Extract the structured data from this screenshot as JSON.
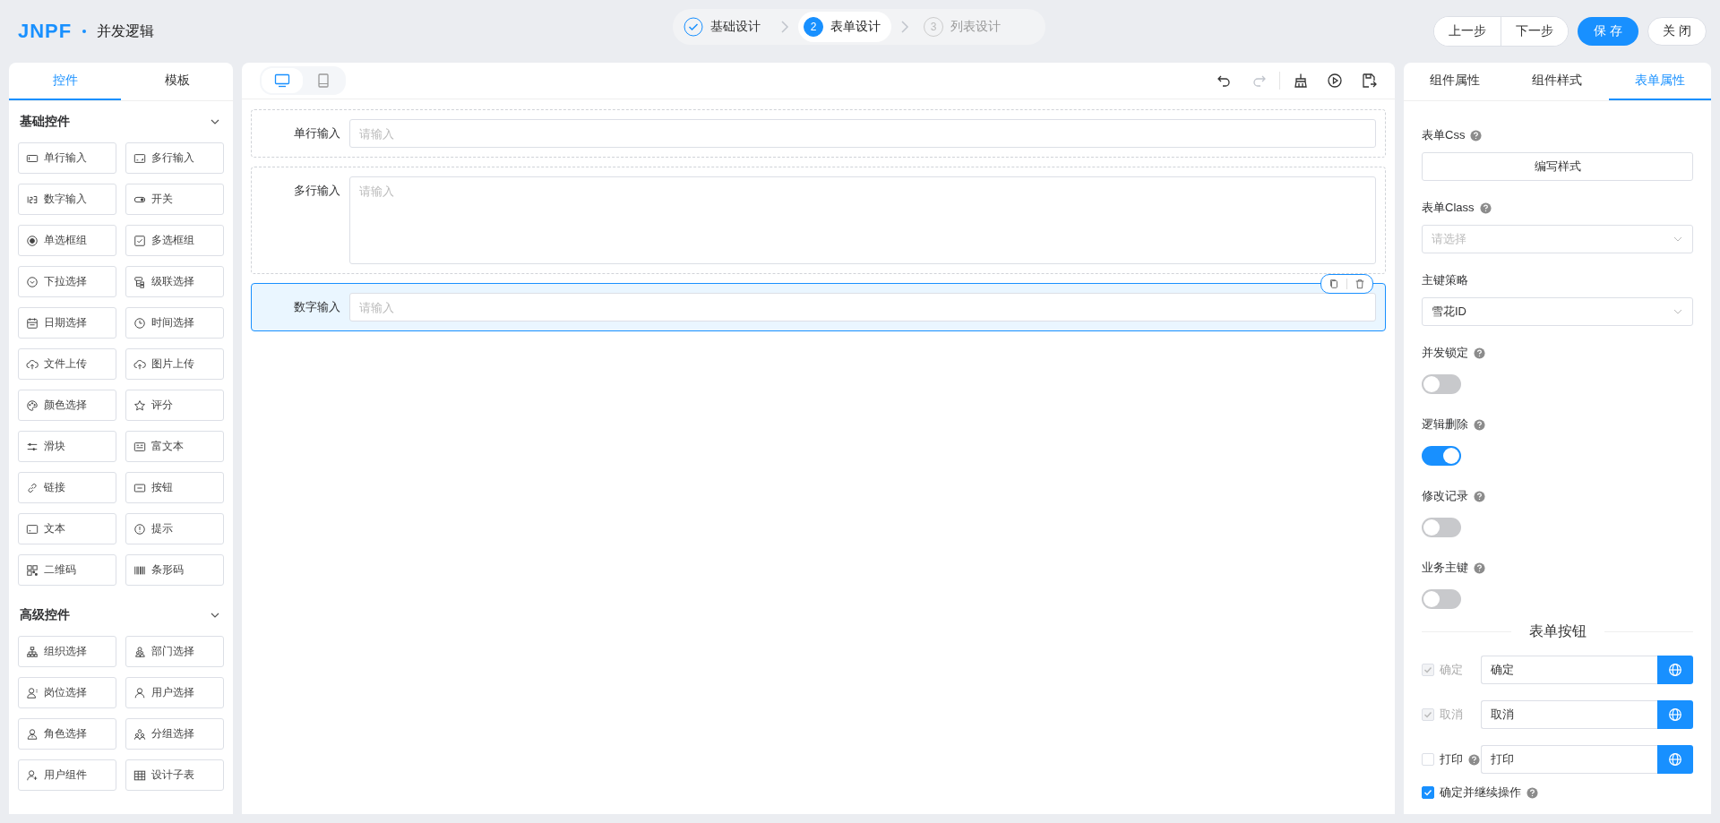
{
  "header": {
    "logo": "JNPF",
    "title": "并发逻辑",
    "steps": [
      {
        "kind": "done",
        "label": "基础设计",
        "selected": false
      },
      {
        "kind": "number",
        "number": "2",
        "label": "表单设计",
        "selected": true
      },
      {
        "kind": "number",
        "number": "3",
        "label": "列表设计",
        "selected": false
      }
    ],
    "buttons": [
      {
        "label": "上一步",
        "kind": "group"
      },
      {
        "label": "下一步",
        "kind": "group"
      },
      {
        "label": "保 存",
        "kind": "primary"
      },
      {
        "label": "关 闭",
        "kind": "plain"
      }
    ]
  },
  "left_panel": {
    "tabs": [
      {
        "label": "控件",
        "selected": true
      },
      {
        "label": "模板",
        "selected": false
      }
    ],
    "groups": [
      {
        "title": "基础控件",
        "expanded": true,
        "items": [
          "单行输入",
          "多行输入",
          "数字输入",
          "开关",
          "单选框组",
          "多选框组",
          "下拉选择",
          "级联选择",
          "日期选择",
          "时间选择",
          "文件上传",
          "图片上传",
          "颜色选择",
          "评分",
          "滑块",
          "富文本",
          "链接",
          "按钮",
          "文本",
          "提示",
          "二维码",
          "条形码"
        ]
      },
      {
        "title": "高级控件",
        "expanded": true,
        "items": [
          "组织选择",
          "部门选择",
          "岗位选择",
          "用户选择",
          "角色选择",
          "分组选择",
          "用户组件",
          "设计子表"
        ]
      }
    ]
  },
  "canvas": {
    "devices": [
      {
        "selected": true
      },
      {
        "selected": false
      }
    ],
    "tools": [
      {
        "disabled": false
      },
      {
        "disabled": true
      },
      {
        "disabled": false
      },
      {
        "disabled": false
      },
      {
        "disabled": false
      }
    ],
    "fields": [
      {
        "kind": "input",
        "label": "单行输入",
        "placeholder": "请输入",
        "selected": false
      },
      {
        "kind": "textarea",
        "label": "多行输入",
        "placeholder": "请输入",
        "selected": false
      },
      {
        "kind": "input",
        "label": "数字输入",
        "placeholder": "请输入",
        "selected": true
      }
    ]
  },
  "right_panel": {
    "tabs": [
      {
        "label": "组件属性",
        "selected": false
      },
      {
        "label": "组件样式",
        "selected": false
      },
      {
        "label": "表单属性",
        "selected": true
      }
    ],
    "props": [
      {
        "kind": "button",
        "label": "表单Css",
        "help": true,
        "text": "编写样式"
      },
      {
        "kind": "select",
        "label": "表单Class",
        "help": true,
        "placeholder": "请选择"
      },
      {
        "kind": "select",
        "label": "主键策略",
        "help": false,
        "value": "雪花ID"
      },
      {
        "kind": "switch",
        "label": "并发锁定",
        "help": true,
        "on": false
      },
      {
        "kind": "switch",
        "label": "逻辑删除",
        "help": true,
        "on": true
      },
      {
        "kind": "switch",
        "label": "修改记录",
        "help": true,
        "on": false
      },
      {
        "kind": "switch",
        "label": "业务主键",
        "help": true,
        "on": false
      }
    ],
    "section_title": "表单按钮",
    "form_buttons": [
      {
        "label": "确定",
        "checked": true,
        "disabled": true,
        "help": false,
        "value": "确定"
      },
      {
        "label": "取消",
        "checked": true,
        "disabled": true,
        "help": false,
        "value": "取消"
      },
      {
        "label": "打印",
        "checked": false,
        "disabled": false,
        "help": true,
        "value": "打印"
      }
    ],
    "continue_option": {
      "label": "确定并继续操作",
      "checked": true,
      "help": true
    }
  }
}
